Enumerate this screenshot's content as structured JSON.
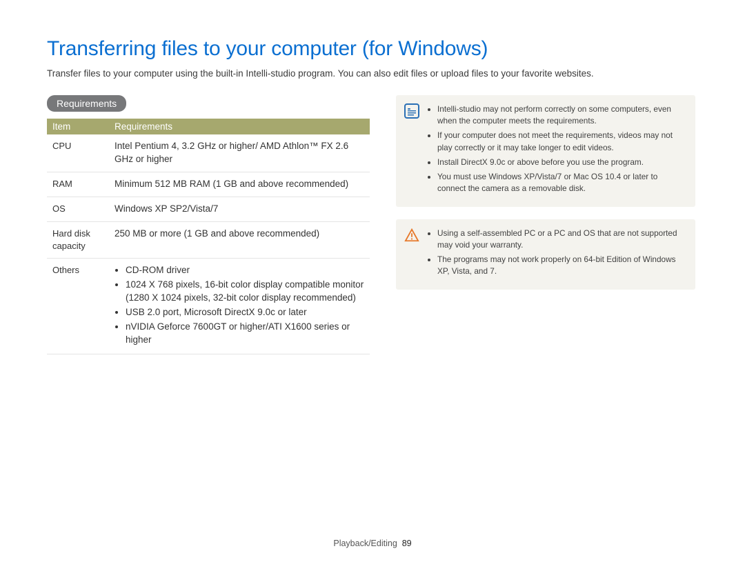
{
  "title": "Transferring files to your computer (for Windows)",
  "intro": "Transfer files to your computer using the built-in Intelli-studio program. You can also edit files or upload files to your favorite websites.",
  "section_label": "Requirements",
  "table": {
    "head_item": "Item",
    "head_req": "Requirements",
    "rows": {
      "cpu": {
        "item": "CPU",
        "req": "Intel Pentium 4, 3.2 GHz or higher/ AMD Athlon™ FX 2.6 GHz or higher"
      },
      "ram": {
        "item": "RAM",
        "req": "Minimum 512 MB RAM (1 GB and above recommended)"
      },
      "os": {
        "item": "OS",
        "req": "Windows XP SP2/Vista/7"
      },
      "hdd": {
        "item": "Hard disk capacity",
        "req": "250 MB or more (1 GB and above recommended)"
      },
      "others": {
        "item": "Others",
        "list": {
          "a": "CD-ROM driver",
          "b": "1024 X 768 pixels, 16-bit color display compatible monitor (1280 X 1024 pixels, 32-bit color display recommended)",
          "c": "USB 2.0 port, Microsoft DirectX 9.0c or later",
          "d": "nVIDIA Geforce 7600GT or higher/ATI X1600 series or higher"
        }
      }
    }
  },
  "note": {
    "a": "Intelli-studio may not perform correctly on some computers, even when the computer meets the requirements.",
    "b": "If your computer does not meet the requirements, videos may not play correctly or it may take longer to edit videos.",
    "c": "Install DirectX 9.0c or above before you use the program.",
    "d": "You must use Windows XP/Vista/7 or Mac OS 10.4 or later to connect the camera as a removable disk."
  },
  "warn": {
    "a": "Using a self-assembled PC or a PC and OS that are not supported may void your warranty.",
    "b": "The programs may not work properly on 64-bit Edition of Windows XP, Vista, and 7."
  },
  "footer": {
    "section": "Playback/Editing",
    "page": "89"
  }
}
